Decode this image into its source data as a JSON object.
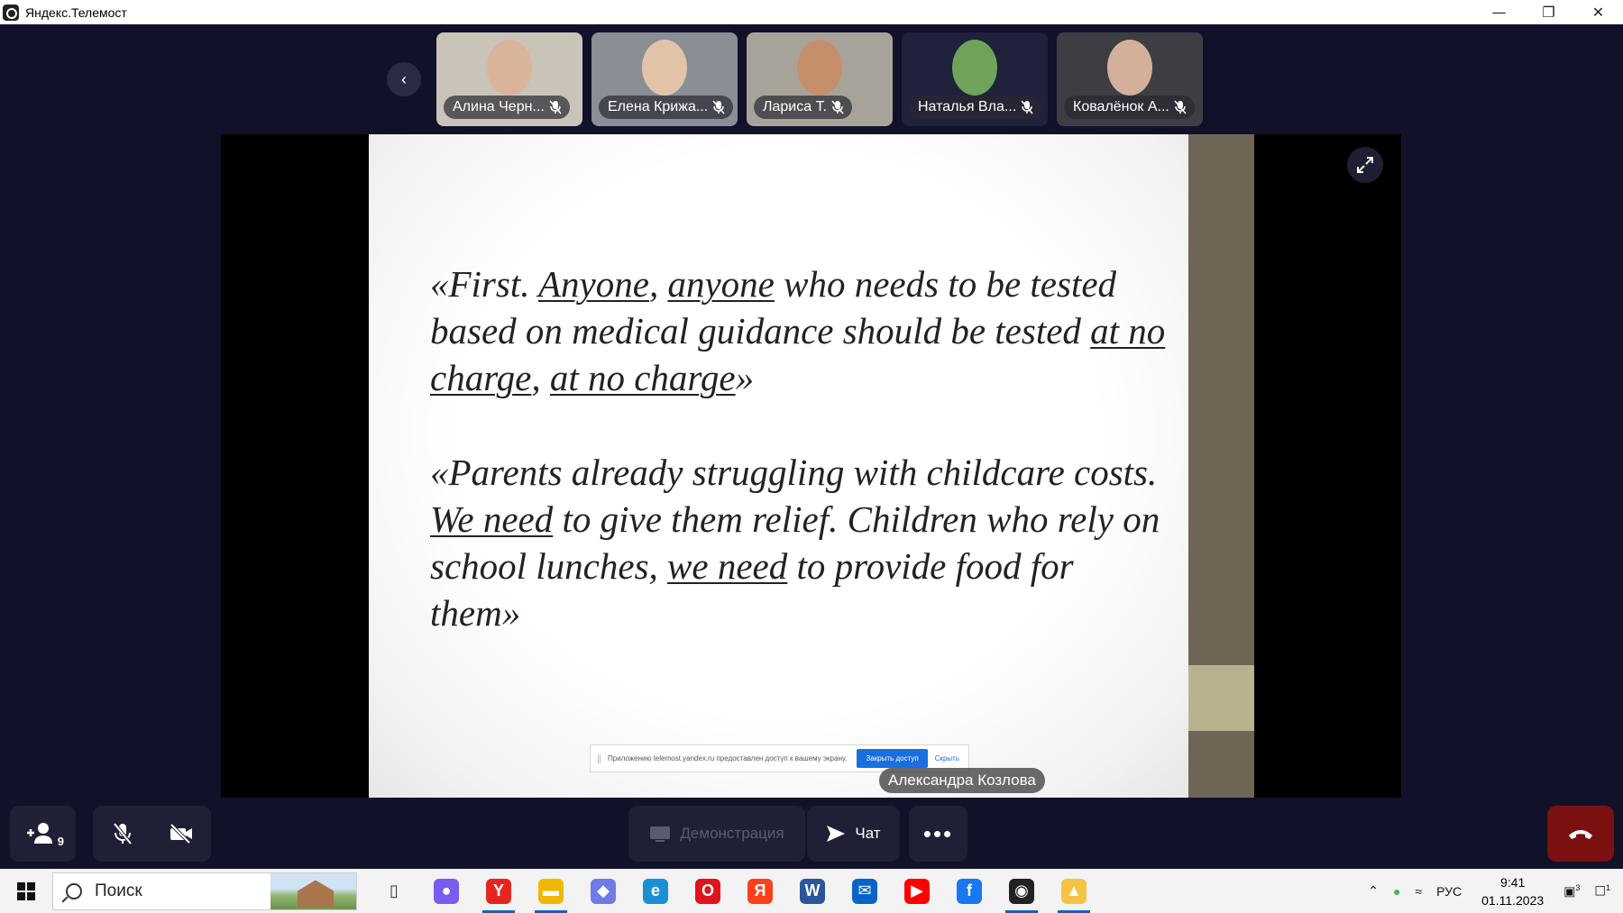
{
  "window": {
    "title": "Яндекс.Телемост",
    "controls": {
      "minimize": "—",
      "restore": "❐",
      "close": "✕"
    }
  },
  "participants": [
    {
      "name": "Алина Черн...",
      "muted": true,
      "bg": "#c9c3b8",
      "face": "#d9b49a"
    },
    {
      "name": "Елена Крижа...",
      "muted": true,
      "bg": "#8a8f96",
      "face": "#e3c3a8"
    },
    {
      "name": "Лариса Т.",
      "muted": true,
      "bg": "#a8a39a",
      "face": "#c58f6b"
    },
    {
      "name": "Наталья Вла...",
      "muted": true,
      "bg": "#20213a",
      "face": "#6fa35a"
    },
    {
      "name": "Ковалёнок А...",
      "muted": true,
      "bg": "#3d3e44",
      "face": "#d4b09a"
    }
  ],
  "slide": {
    "quote1_parts": [
      "«First. ",
      "Anyone",
      ", ",
      "anyone",
      " who needs to be tested based on medical guidance should be tested ",
      "at no charge",
      ", ",
      "at no charge",
      "»"
    ],
    "quote2_parts": [
      "«Parents already struggling with childcare costs. ",
      "We need",
      " to give them relief. Children who rely on school lunches, ",
      "we need",
      " to provide food for them»"
    ]
  },
  "share_notice": {
    "text": "Приложению telemost.yandex.ru предоставлен доступ к вашему экрану.",
    "stop_label": "Закрыть доступ",
    "hide_label": "Скрыть"
  },
  "active_speaker": "Александра Козлова",
  "controls": {
    "participants_count": "9",
    "demo_label": "Демонстрация",
    "chat_label": "Чат",
    "more_label": "•••"
  },
  "taskbar": {
    "search_placeholder": "Поиск",
    "apps": [
      {
        "name": "task-view",
        "glyph": "▯",
        "color": "#333333",
        "active": false
      },
      {
        "name": "alice",
        "glyph": "●",
        "color": "#7a5cf0",
        "active": false
      },
      {
        "name": "yandex-browser",
        "glyph": "Y",
        "color": "#e52620",
        "active": true
      },
      {
        "name": "file-explorer",
        "glyph": "▬",
        "color": "#f2b705",
        "active": true
      },
      {
        "name": "copilot",
        "glyph": "◆",
        "color": "#6f7be6",
        "active": false
      },
      {
        "name": "edge",
        "glyph": "e",
        "color": "#1b8fd6",
        "active": false
      },
      {
        "name": "opera",
        "glyph": "O",
        "color": "#e0121b",
        "active": false
      },
      {
        "name": "yandex",
        "glyph": "Я",
        "color": "#fc3f1d",
        "active": false
      },
      {
        "name": "word",
        "glyph": "W",
        "color": "#2b579a",
        "active": false
      },
      {
        "name": "mail",
        "glyph": "✉",
        "color": "#0a64c8",
        "active": false
      },
      {
        "name": "youtube",
        "glyph": "▶",
        "color": "#ff0000",
        "active": false
      },
      {
        "name": "facebook",
        "glyph": "f",
        "color": "#1877f2",
        "active": false
      },
      {
        "name": "telemost",
        "glyph": "◉",
        "color": "#222222",
        "active": true
      },
      {
        "name": "yandex-disk",
        "glyph": "▲",
        "color": "#f6c445",
        "active": true
      }
    ],
    "language": "РУС",
    "time": "9:41",
    "date": "01.11.2023",
    "notifications_count": "1",
    "badge_count": "3"
  }
}
